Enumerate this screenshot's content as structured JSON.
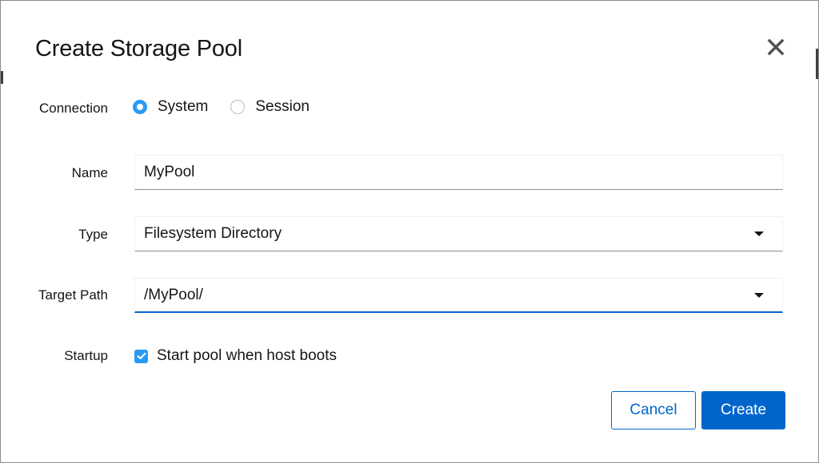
{
  "dialog": {
    "title": "Create Storage Pool",
    "close_icon": "close-icon"
  },
  "connection": {
    "label": "Connection",
    "options": [
      {
        "label": "System",
        "checked": true
      },
      {
        "label": "Session",
        "checked": false
      }
    ]
  },
  "name": {
    "label": "Name",
    "value": "MyPool"
  },
  "type": {
    "label": "Type",
    "value": "Filesystem Directory"
  },
  "target_path": {
    "label": "Target Path",
    "value": "/MyPool/"
  },
  "startup": {
    "label": "Startup",
    "checkbox_label": "Start pool when host boots",
    "checked": true
  },
  "buttons": {
    "cancel": "Cancel",
    "create": "Create"
  },
  "colors": {
    "accent": "#0066cc",
    "radio_checked": "#2b9af3",
    "text": "#151515"
  }
}
